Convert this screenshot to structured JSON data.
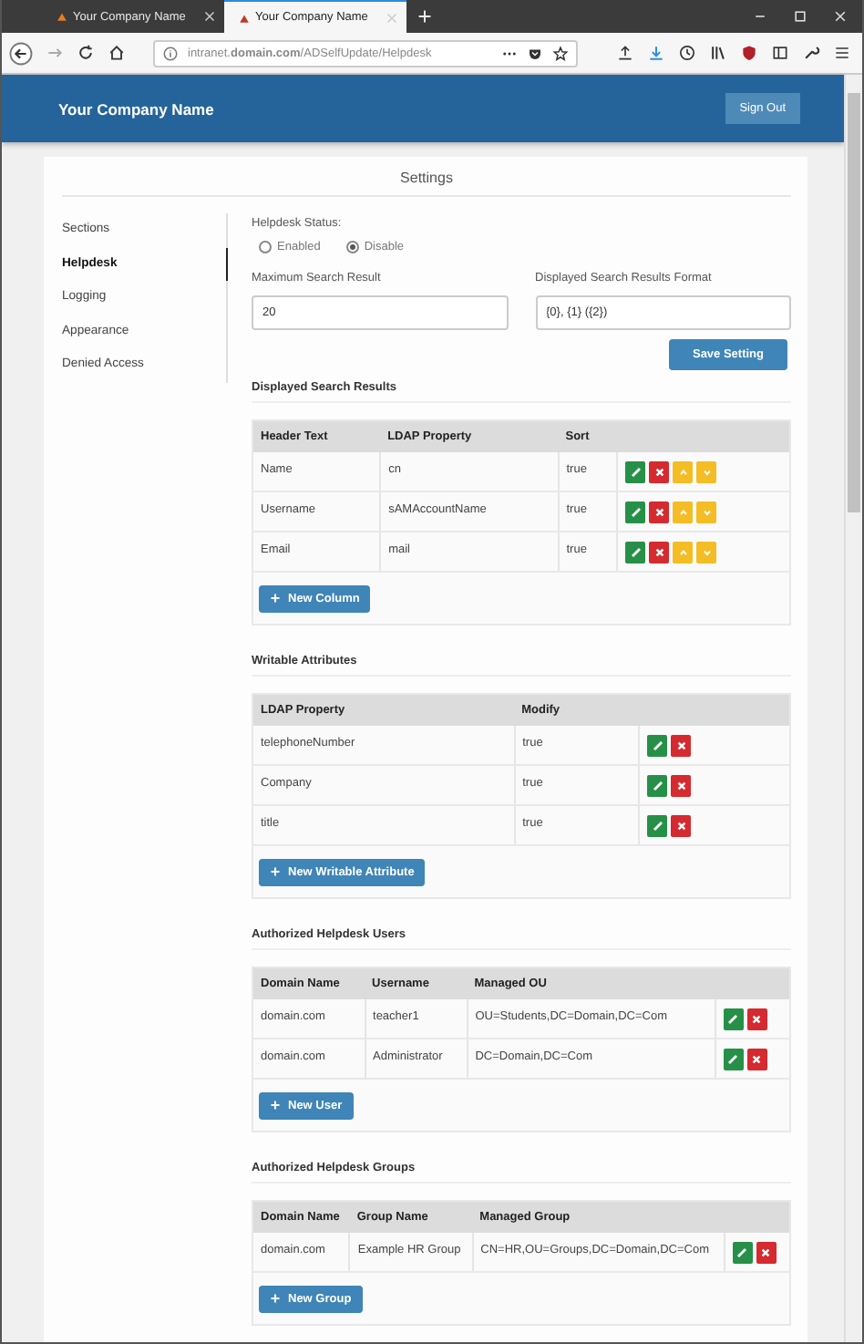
{
  "browser": {
    "tabs": [
      {
        "title": "Your Company Name",
        "selected": false
      },
      {
        "title": "Your Company Name",
        "selected": true
      }
    ],
    "url": "intranet.**domain.com**/ADSelfUpdate/Helpdesk"
  },
  "header": {
    "brand": "Your Company Name",
    "sign_out": "Sign Out"
  },
  "settings": {
    "title": "Settings",
    "nav": [
      {
        "label": "Sections",
        "selected": false
      },
      {
        "label": "Helpdesk",
        "selected": true
      },
      {
        "label": "Logging",
        "selected": false
      },
      {
        "label": "Appearance",
        "selected": false
      },
      {
        "label": "Denied Access",
        "selected": false
      }
    ],
    "status": {
      "label": "Helpdesk Status:",
      "options": [
        {
          "label": "Enabled",
          "selected": false
        },
        {
          "label": "Disable",
          "selected": true
        }
      ]
    },
    "fields": [
      {
        "label": "Maximum Search Result",
        "value": "20"
      },
      {
        "label": "Displayed Search Results Format",
        "value": "{0}, {1} ({2})"
      }
    ],
    "save_button": "Save Setting",
    "sections": [
      {
        "title": "Displayed Search Results",
        "columns": [
          "Header Text",
          "LDAP Property",
          "Sort"
        ],
        "rows": [
          {
            "cells": [
              "Name",
              "cn",
              "true"
            ],
            "actions": [
              {
                "kind": "edit"
              },
              {
                "kind": "delete"
              },
              {
                "kind": "move_up"
              },
              {
                "kind": "move_down"
              }
            ]
          },
          {
            "cells": [
              "Username",
              "sAMAccountName",
              "true"
            ],
            "actions": [
              {
                "kind": "edit"
              },
              {
                "kind": "delete"
              },
              {
                "kind": "move_up"
              },
              {
                "kind": "move_down"
              }
            ]
          },
          {
            "cells": [
              "Email",
              "mail",
              "true"
            ],
            "actions": [
              {
                "kind": "edit"
              },
              {
                "kind": "delete"
              },
              {
                "kind": "move_up"
              },
              {
                "kind": "move_down"
              }
            ]
          }
        ],
        "add_button": "New Column"
      },
      {
        "title": "Writable Attributes",
        "columns": [
          "LDAP Property",
          "Modify"
        ],
        "rows": [
          {
            "cells": [
              "telephoneNumber",
              "true"
            ],
            "actions": [
              {
                "kind": "edit"
              },
              {
                "kind": "delete"
              }
            ]
          },
          {
            "cells": [
              "Company",
              "true"
            ],
            "actions": [
              {
                "kind": "edit"
              },
              {
                "kind": "delete"
              }
            ]
          },
          {
            "cells": [
              "title",
              "true"
            ],
            "actions": [
              {
                "kind": "edit"
              },
              {
                "kind": "delete"
              }
            ]
          }
        ],
        "add_button": "New Writable Attribute"
      },
      {
        "title": "Authorized Helpdesk Users",
        "columns": [
          "Domain Name",
          "Username",
          "Managed OU"
        ],
        "rows": [
          {
            "cells": [
              "domain.com",
              "teacher1",
              "OU=Students,DC=Domain,DC=Com"
            ],
            "actions": [
              {
                "kind": "edit"
              },
              {
                "kind": "delete"
              }
            ]
          },
          {
            "cells": [
              "domain.com",
              "Administrator",
              "DC=Domain,DC=Com"
            ],
            "actions": [
              {
                "kind": "edit"
              },
              {
                "kind": "delete"
              }
            ]
          }
        ],
        "add_button": "New User"
      },
      {
        "title": "Authorized Helpdesk Groups",
        "columns": [
          "Domain Name",
          "Group Name",
          "Managed Group"
        ],
        "rows": [
          {
            "cells": [
              "domain.com",
              "Example HR Group",
              "CN=HR,OU=Groups,DC=Domain,DC=Com"
            ],
            "actions": [
              {
                "kind": "edit"
              },
              {
                "kind": "delete"
              }
            ]
          }
        ],
        "add_button": "New Group"
      }
    ]
  }
}
